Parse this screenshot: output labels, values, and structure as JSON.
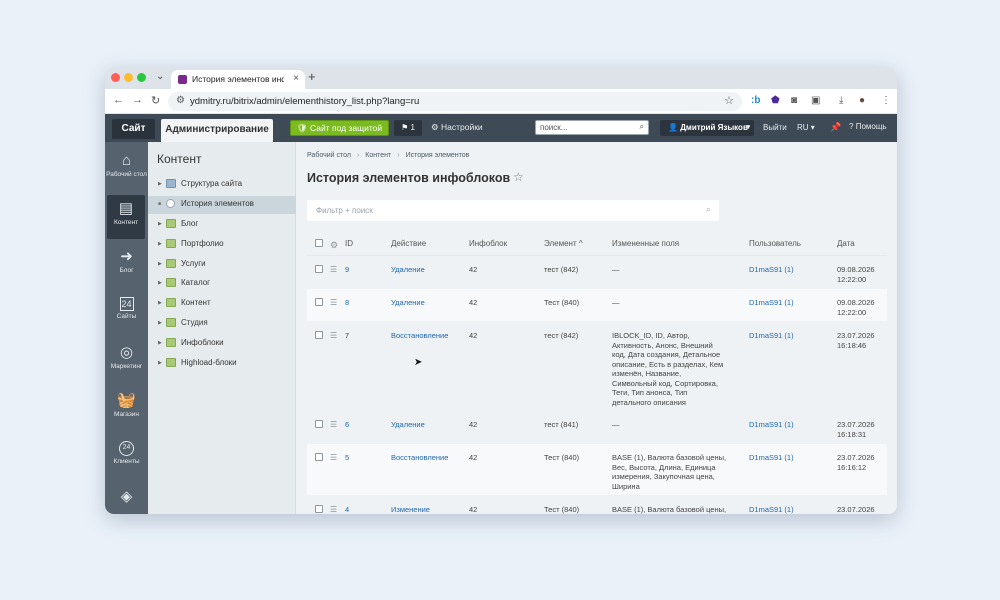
{
  "browser": {
    "tab_title": "История элементов инфобл...",
    "url": "ydmitry.ru/bitrix/admin/elementhistory_list.php?lang=ru",
    "new_tab_icon": "+",
    "close_icon": "×"
  },
  "topbar": {
    "site_label": "Сайт",
    "admin_label": "Администрирование",
    "protect_label": "Сайт под защитой",
    "notif_count": "1",
    "settings_label": "Настройки",
    "search_placeholder": "поиск...",
    "user_name": "Дмитрий Языков",
    "logout_label": "Выйти",
    "lang_label": "RU",
    "help_label": "Помощь"
  },
  "leftnav": [
    {
      "label": "Рабочий стол",
      "icon": "home-icon"
    },
    {
      "label": "Контент",
      "icon": "document-icon"
    },
    {
      "label": "Блог",
      "icon": "arrow-circle-icon"
    },
    {
      "label": "Сайты",
      "icon": "calendar-icon"
    },
    {
      "label": "Маркетинг",
      "icon": "target-icon"
    },
    {
      "label": "Магазин",
      "icon": "basket-icon"
    },
    {
      "label": "Клиенты",
      "icon": "clients-icon"
    }
  ],
  "leftnav_extra": {
    "icon": "layers-icon",
    "calendar_day": "24",
    "clients_badge": "24"
  },
  "tree": {
    "title": "Контент",
    "items": [
      {
        "label": "Структура сайта"
      },
      {
        "label": "История элементов"
      },
      {
        "label": "Блог"
      },
      {
        "label": "Портфолио"
      },
      {
        "label": "Услуги"
      },
      {
        "label": "Каталог"
      },
      {
        "label": "Контент"
      },
      {
        "label": "Студия"
      },
      {
        "label": "Инфоблоки"
      },
      {
        "label": "Highload-блоки"
      }
    ]
  },
  "main": {
    "breadcrumbs": [
      "Рабочий стол",
      "Контент",
      "История элементов"
    ],
    "breadcrumb_sep": "›",
    "title": "История элементов инфоблоков",
    "filter_placeholder": "Фильтр + поиск",
    "columns": [
      "ID",
      "Действие",
      "Инфоблок",
      "Элемент",
      "Измененные поля",
      "Пользователь",
      "Дата"
    ],
    "sort_indicator": "^",
    "rows": [
      {
        "id": "9",
        "action": "Удаление",
        "iblock": "42",
        "element": "тест (842)",
        "fields": "—",
        "user": "D1maS91 (1)",
        "date": "09.08.2026\n12:22:00"
      },
      {
        "id": "8",
        "action": "Удаление",
        "iblock": "42",
        "element": "Тест (840)",
        "fields": "—",
        "user": "D1maS91 (1)",
        "date": "09.08.2026\n12:22:00"
      },
      {
        "id": "7",
        "action": "Восстановление",
        "iblock": "42",
        "element": "тест (842)",
        "fields": "IBLOCK_ID, ID, Автор,\nАктивность, Анонс, Внешний\nкод, Дата создания, Детальное\nописание, Есть в разделах, Кем\nизменён, Название,\nСимвольный код, Сортировка,\nТеги, Тип анонса, Тип\nдетального описания",
        "user": "D1maS91 (1)",
        "date": "23.07.2026\n16:18:46"
      },
      {
        "id": "6",
        "action": "Удаление",
        "iblock": "42",
        "element": "тест (841)",
        "fields": "—",
        "user": "D1maS91 (1)",
        "date": "23.07.2026\n16:18:31"
      },
      {
        "id": "5",
        "action": "Восстановление",
        "iblock": "42",
        "element": "Тест (840)",
        "fields": "BASE (1), Валюта базовой цены,\nВес, Высота, Длина, Единица\nизмерения, Закупочная цена,\nШирина",
        "user": "D1maS91 (1)",
        "date": "23.07.2026\n16:16:12"
      },
      {
        "id": "4",
        "action": "Изменение",
        "iblock": "42",
        "element": "Тест (840)",
        "fields": "BASE (1), Валюта базовой цены,",
        "user": "D1maS91 (1)",
        "date": "23.07.2026"
      }
    ]
  }
}
